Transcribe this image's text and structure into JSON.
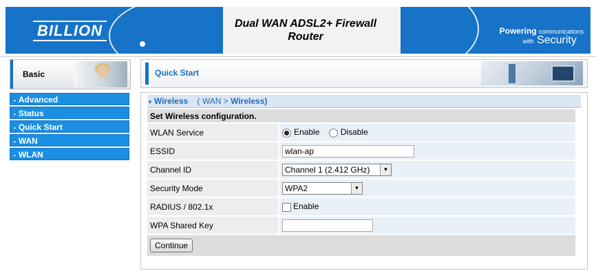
{
  "header": {
    "logo": "BILLION",
    "title_line1": "Dual WAN ADSL2+ Firewall",
    "title_line2": "Router",
    "tagline_powering": "Powering",
    "tagline_comms": "communications",
    "tagline_with": "with",
    "tagline_security": "Security"
  },
  "sidebar": {
    "basic_label": "Basic",
    "items": [
      {
        "label": "Advanced"
      },
      {
        "label": "Status"
      },
      {
        "label": "Quick Start"
      },
      {
        "label": "WAN"
      },
      {
        "label": "WLAN"
      }
    ],
    "bullet": "•"
  },
  "main": {
    "section_title": "Quick Start",
    "panel_title": "Wireless",
    "breadcrumb_prefix": "( WAN >",
    "breadcrumb_current": "Wireless)",
    "table_heading": "Set Wireless configuration.",
    "wlan_service": {
      "label": "WLAN Service",
      "enable": "Enable",
      "disable": "Disable",
      "selected": "Enable"
    },
    "essid": {
      "label": "ESSID",
      "value": "wlan-ap"
    },
    "channel": {
      "label": "Channel ID",
      "value": "Channel 1 (2.412 GHz)"
    },
    "security": {
      "label": "Security Mode",
      "value": "WPA2"
    },
    "radius": {
      "label": "RADIUS / 802.1x",
      "checkbox_label": "Enable",
      "checked": false
    },
    "wpa_key": {
      "label": "WPA Shared Key",
      "value": ""
    },
    "continue_label": "Continue"
  },
  "colors": {
    "accent": "#1673c7",
    "menu": "#1a8fe3",
    "link": "#1a6fc0"
  }
}
